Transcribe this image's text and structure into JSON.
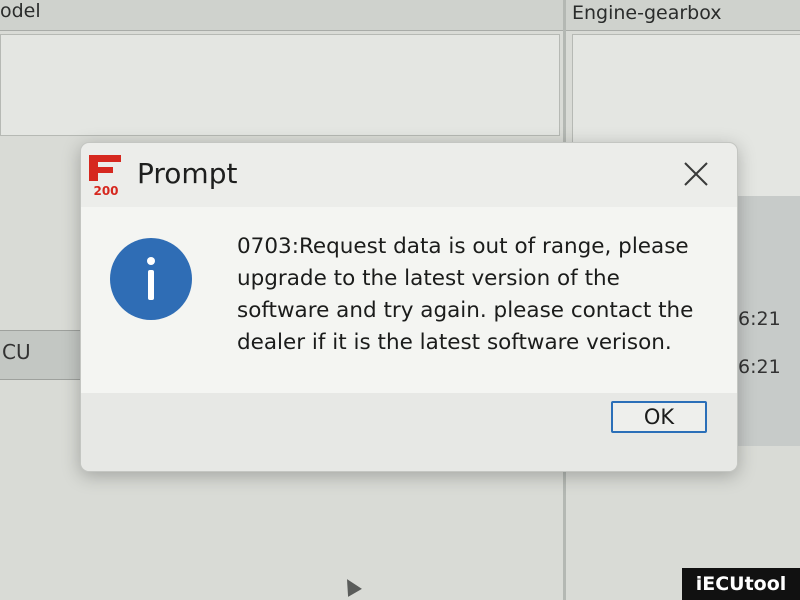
{
  "background": {
    "left_column_title": "odel",
    "right_column_title": "Engine-gearbox",
    "row_label": "CU",
    "times": [
      "6:21",
      "6:21"
    ]
  },
  "dialog": {
    "title": "Prompt",
    "logo_text": "200",
    "message_lines": [
      "0703:Request data is out of range, please",
      "upgrade to the latest version of the",
      "software and try again. please contact the",
      "dealer if it is the latest software verison."
    ],
    "ok_label": "OK",
    "close_icon": "close-icon",
    "info_icon": "info-icon",
    "info_color": "#2f6db5"
  },
  "watermark": "iECUtool"
}
